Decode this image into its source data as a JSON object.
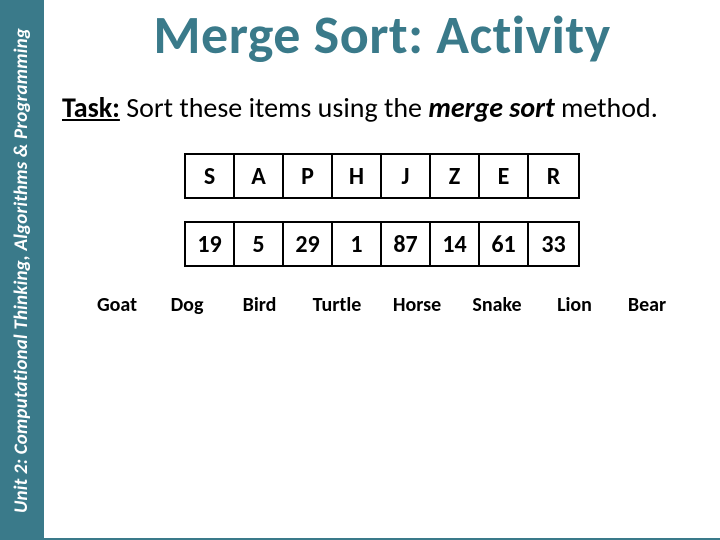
{
  "sidebar": {
    "unit_label": "Unit 2: Computational Thinking, Algorithms & Programming"
  },
  "slide": {
    "title": "Merge Sort: Activity",
    "task_label": "Task:",
    "task_text_1": " Sort these items using the ",
    "task_method": "merge sort",
    "task_text_2": " method."
  },
  "letters": [
    "S",
    "A",
    "P",
    "H",
    "J",
    "Z",
    "E",
    "R"
  ],
  "numbers": [
    "19",
    "5",
    "29",
    "1",
    "87",
    "14",
    "61",
    "33"
  ],
  "animals": [
    "Goat",
    "Dog",
    "Bird",
    "Turtle",
    "Horse",
    "Snake",
    "Lion",
    "Bear"
  ]
}
